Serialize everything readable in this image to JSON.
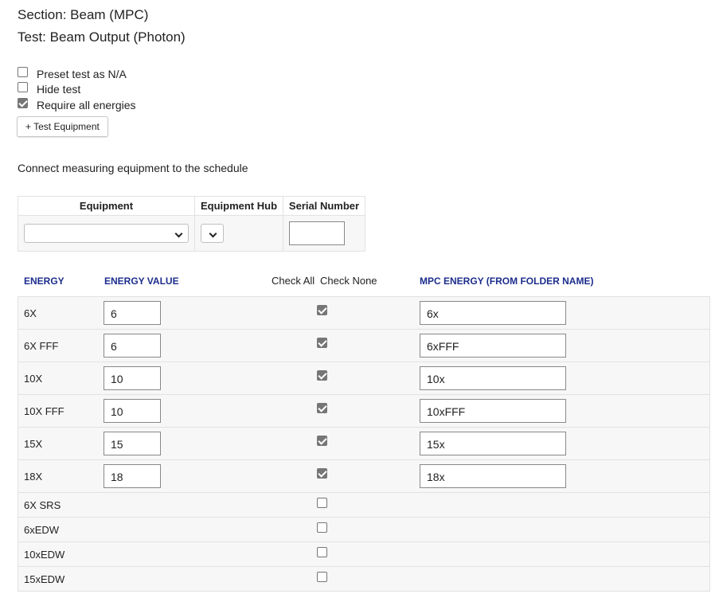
{
  "header": {
    "section": "Section: Beam (MPC)",
    "test": "Test: Beam Output (Photon)"
  },
  "options": [
    {
      "label": "Preset test as N/A",
      "checked": false
    },
    {
      "label": "Hide test",
      "checked": false
    },
    {
      "label": "Require all energies",
      "checked": true
    }
  ],
  "buttons": {
    "test_equipment": "+ Test Equipment"
  },
  "equipment": {
    "instruction": "Connect measuring equipment to the schedule",
    "columns": [
      "Equipment",
      "Equipment Hub",
      "Serial Number"
    ],
    "selected_equipment": "",
    "selected_hub": "",
    "serial_number": ""
  },
  "energies": {
    "columns": {
      "energy": "ENERGY",
      "energy_value": "ENERGY VALUE",
      "check_all": "Check All",
      "check_none": "Check None",
      "mpc_energy": "MPC ENERGY (FROM FOLDER NAME)"
    },
    "header_color": "#1c2d8c",
    "rows": [
      {
        "energy": "6X",
        "value": "6",
        "checked": true,
        "mpc": "6x"
      },
      {
        "energy": "6X FFF",
        "value": "6",
        "checked": true,
        "mpc": "6xFFF"
      },
      {
        "energy": "10X",
        "value": "10",
        "checked": true,
        "mpc": "10x"
      },
      {
        "energy": "10X FFF",
        "value": "10",
        "checked": true,
        "mpc": "10xFFF"
      },
      {
        "energy": "15X",
        "value": "15",
        "checked": true,
        "mpc": "15x"
      },
      {
        "energy": "18X",
        "value": "18",
        "checked": true,
        "mpc": "18x"
      },
      {
        "energy": "6X SRS",
        "value": "",
        "checked": false,
        "mpc": ""
      },
      {
        "energy": "6xEDW",
        "value": "",
        "checked": false,
        "mpc": ""
      },
      {
        "energy": "10xEDW",
        "value": "",
        "checked": false,
        "mpc": ""
      },
      {
        "energy": "15xEDW",
        "value": "",
        "checked": false,
        "mpc": ""
      }
    ]
  }
}
